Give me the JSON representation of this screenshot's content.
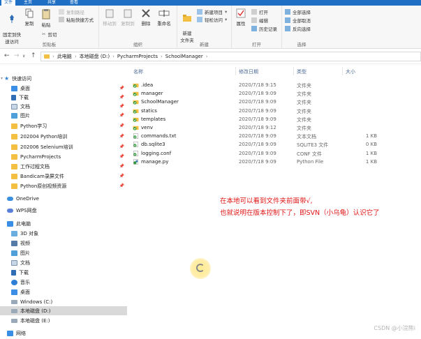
{
  "tabs": [
    "文件",
    "主页",
    "共享",
    "查看"
  ],
  "ribbon": {
    "clipboard": {
      "pin": "固定到快\n速访问",
      "copy": "复制",
      "paste": "粘贴",
      "copy_path": "复制路径",
      "paste_shortcut": "粘贴快捷方式",
      "cut": "剪切",
      "group": "剪贴板"
    },
    "organize": {
      "move_to": "移动到",
      "copy_to": "复制到",
      "delete": "删除",
      "rename": "重命名",
      "group": "组织"
    },
    "new": {
      "new_folder": "新建\n文件夹",
      "new_item": "新建项目",
      "easy_access": "轻松访问",
      "group": "新建"
    },
    "open": {
      "properties": "属性",
      "open": "打开",
      "edit": "编辑",
      "history": "历史记录",
      "group": "打开"
    },
    "select": {
      "select_all": "全部选择",
      "select_none": "全部取消",
      "invert": "反向选择",
      "group": "选择"
    }
  },
  "nav": {
    "back": "←",
    "forward": "→",
    "up": "↑",
    "path": [
      "此电脑",
      "本地磁盘 (D:)",
      "PycharmProjects",
      "SchoolManager"
    ]
  },
  "sidebar": {
    "quick_access": "快速访问",
    "quick_items": [
      "桌面",
      "下载",
      "文档",
      "图片",
      "Python学习",
      "202004 Python培训",
      "202006 Selenium培训",
      "PycharmProjects",
      "工作过程文档",
      "Bandicam录屏文件",
      "Python原创视频资源"
    ],
    "onedrive": "OneDrive",
    "wps": "WPS网盘",
    "this_pc": "此电脑",
    "pc_items": [
      "3D 对象",
      "视频",
      "图片",
      "文档",
      "下载",
      "音乐",
      "桌面",
      "Windows (C:)",
      "本地磁盘 (D:)",
      "本地磁盘 (E:)"
    ],
    "network": "网络"
  },
  "columns": {
    "name": "名称",
    "date": "修改日期",
    "type": "类型",
    "size": "大小"
  },
  "files": [
    {
      "name": ".idea",
      "date": "2020/7/18 9:15",
      "type": "文件夹",
      "size": "",
      "kind": "folder"
    },
    {
      "name": "manager",
      "date": "2020/7/18 9:09",
      "type": "文件夹",
      "size": "",
      "kind": "folder"
    },
    {
      "name": "SchoolManager",
      "date": "2020/7/18 9:09",
      "type": "文件夹",
      "size": "",
      "kind": "folder"
    },
    {
      "name": "statics",
      "date": "2020/7/18 9:09",
      "type": "文件夹",
      "size": "",
      "kind": "folder"
    },
    {
      "name": "templates",
      "date": "2020/7/18 9:09",
      "type": "文件夹",
      "size": "",
      "kind": "folder"
    },
    {
      "name": "venv",
      "date": "2020/7/18 9:12",
      "type": "文件夹",
      "size": "",
      "kind": "folder"
    },
    {
      "name": "commands.txt",
      "date": "2020/7/18 9:09",
      "type": "文本文档",
      "size": "1 KB",
      "kind": "file"
    },
    {
      "name": "db.sqlite3",
      "date": "2020/7/18 9:09",
      "type": "SQLITE3 文件",
      "size": "0 KB",
      "kind": "file"
    },
    {
      "name": "logging.conf",
      "date": "2020/7/18 9:09",
      "type": "CONF 文件",
      "size": "1 KB",
      "kind": "file"
    },
    {
      "name": "manage.py",
      "date": "2020/7/18 9:09",
      "type": "Python File",
      "size": "1 KB",
      "kind": "py"
    }
  ],
  "annotation": {
    "line1": "在本地可以看到文件夹前面带√,",
    "line2": "也就说明在版本控制下了，即SVN（小乌龟）认识它了"
  },
  "watermark": "CSDN @小浣熊i",
  "colors": {
    "ribbon_tab": "#1f6fc4",
    "folder": "#f3c044",
    "svn_ok": "#2e9a3a",
    "annotation": "#e01414"
  }
}
